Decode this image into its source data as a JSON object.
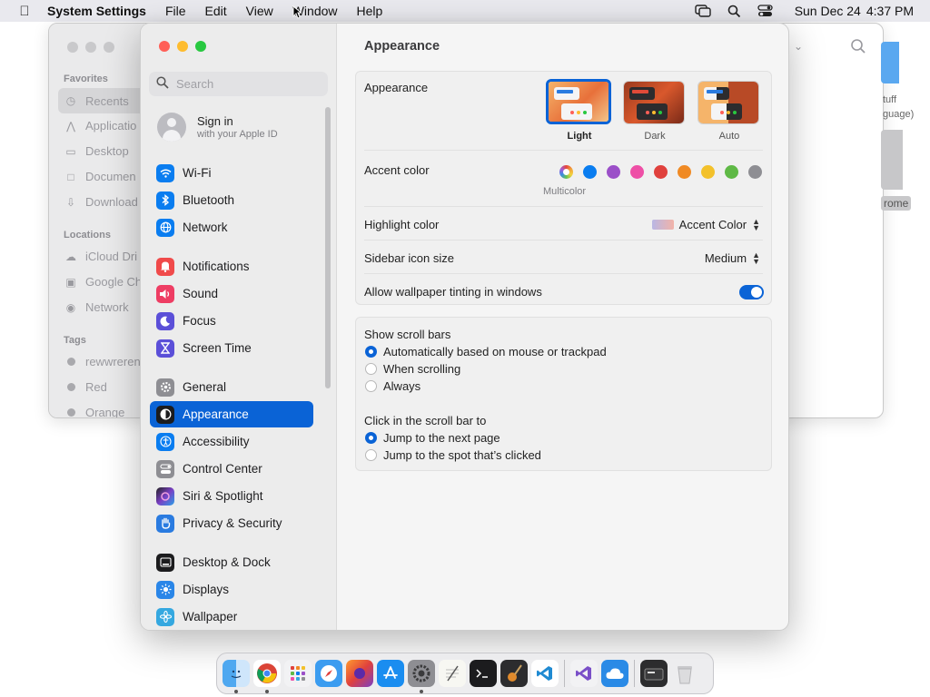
{
  "menubar": {
    "app_name": "System Settings",
    "menus": [
      "File",
      "Edit",
      "View",
      "Window",
      "Help"
    ],
    "clock_date": "Sun Dec 24",
    "clock_time": "4:37 PM"
  },
  "finder": {
    "favorites_label": "Favorites",
    "favorites": [
      "Recents",
      "Applicatio",
      "Desktop",
      "Documen",
      "Download"
    ],
    "locations_label": "Locations",
    "locations": [
      "iCloud Dri",
      "Google Ch",
      "Network"
    ],
    "tags_label": "Tags",
    "tags": [
      "rewwreren",
      "Red",
      "Orange"
    ],
    "desktop_file_label_1": "tuff",
    "desktop_file_label_2": "guage)",
    "desktop_drive_label": "rome"
  },
  "settings": {
    "search_placeholder": "Search",
    "signin_title": "Sign in",
    "signin_subtitle": "with your Apple ID",
    "nav": [
      {
        "label": "Wi-Fi",
        "color": "#0a7df0"
      },
      {
        "label": "Bluetooth",
        "color": "#0a7df0"
      },
      {
        "label": "Network",
        "color": "#0a7df0"
      },
      {
        "label": "Notifications",
        "color": "#f04a4a"
      },
      {
        "label": "Sound",
        "color": "#ee3d63"
      },
      {
        "label": "Focus",
        "color": "#5b4fd8"
      },
      {
        "label": "Screen Time",
        "color": "#5b4fd8"
      },
      {
        "label": "General",
        "color": "#8e8e93"
      },
      {
        "label": "Appearance",
        "color": "#1c1c1e"
      },
      {
        "label": "Accessibility",
        "color": "#0a7df0"
      },
      {
        "label": "Control Center",
        "color": "#8e8e93"
      },
      {
        "label": "Siri & Spotlight",
        "color": "#7a3fc4"
      },
      {
        "label": "Privacy & Security",
        "color": "#2a7be0"
      },
      {
        "label": "Desktop & Dock",
        "color": "#1c1c1e"
      },
      {
        "label": "Displays",
        "color": "#2a86e8"
      },
      {
        "label": "Wallpaper",
        "color": "#35a8e0"
      }
    ],
    "page_title": "Appearance",
    "appearance_label": "Appearance",
    "themes": [
      "Light",
      "Dark",
      "Auto"
    ],
    "accent_label": "Accent color",
    "accent_colors": [
      "#0a7df0",
      "#9b4fc8",
      "#ee4fa6",
      "#e0413d",
      "#f08a24",
      "#f3c12b",
      "#5fb946",
      "#8e8e93"
    ],
    "multicolor_label": "Multicolor",
    "highlight_label": "Highlight color",
    "highlight_value": "Accent Color",
    "sidebar_icon_label": "Sidebar icon size",
    "sidebar_icon_value": "Medium",
    "tinting_label": "Allow wallpaper tinting in windows",
    "tinting_on": true,
    "scrollbars_label": "Show scroll bars",
    "scrollbar_options": [
      "Automatically based on mouse or trackpad",
      "When scrolling",
      "Always"
    ],
    "click_label": "Click in the scroll bar to",
    "click_options": [
      "Jump to the next page",
      "Jump to the spot that’s clicked"
    ],
    "help": "?"
  },
  "dock": {
    "apps": [
      "finder",
      "chrome",
      "launchpad",
      "safari",
      "firefox",
      "app-store",
      "system-settings",
      "textedit",
      "terminal",
      "garageband",
      "vscode",
      "visual-studio",
      "icloud",
      "screenshot",
      "trash"
    ]
  }
}
